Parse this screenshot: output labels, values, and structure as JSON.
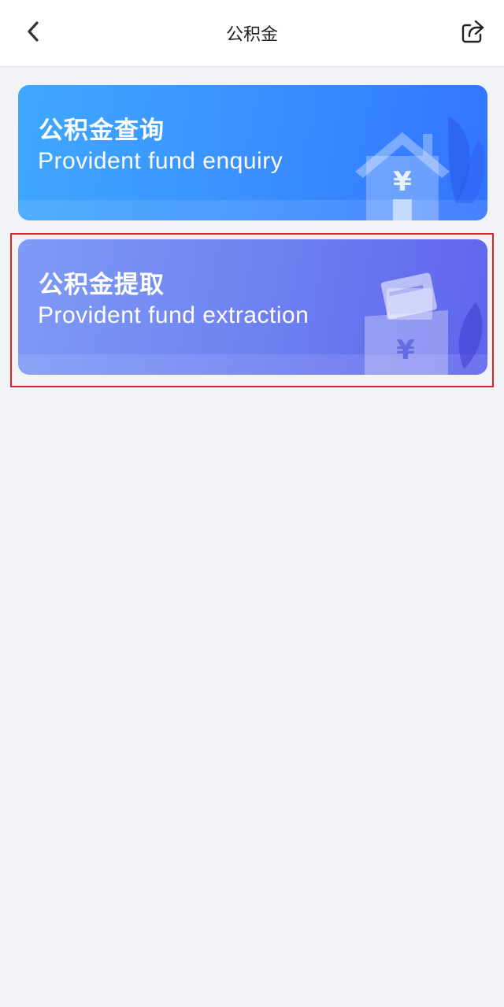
{
  "header": {
    "title": "公积金",
    "back_icon": "chevron-left-icon",
    "share_icon": "share-icon"
  },
  "cards": [
    {
      "title_cn": "公积金查询",
      "title_en": "Provident fund enquiry",
      "icon": "house-yen-icon",
      "color_start": "#3fa8ff",
      "color_end": "#3273ff"
    },
    {
      "title_cn": "公积金提取",
      "title_en": "Provident fund extraction",
      "icon": "wallet-yen-icon",
      "color_start": "#7f9bf6",
      "color_end": "#5f64ec"
    }
  ],
  "highlight": {
    "target": "cards.1",
    "color": "#d8262b"
  }
}
